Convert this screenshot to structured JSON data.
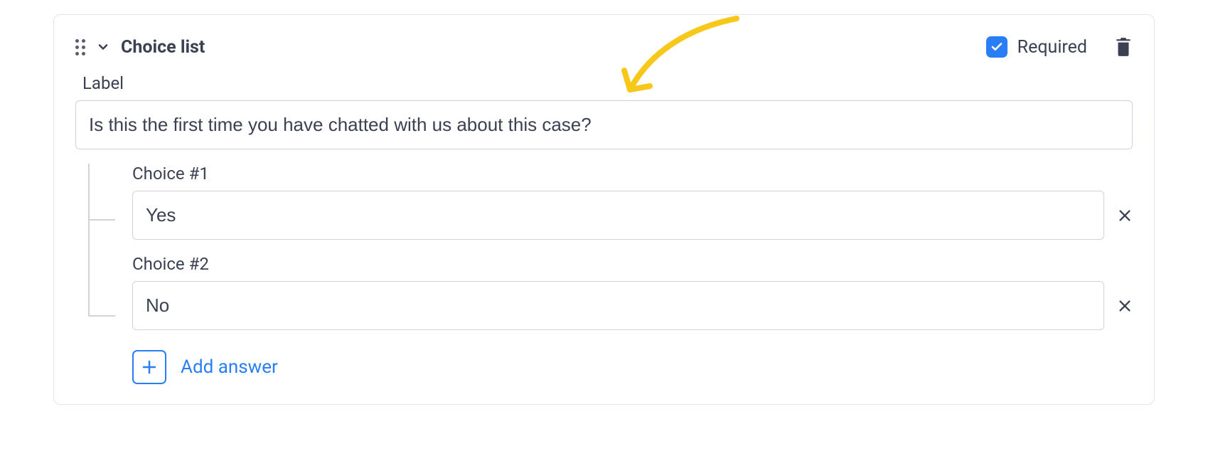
{
  "field": {
    "type_label": "Choice list",
    "required_label": "Required",
    "required_checked": true,
    "label_caption": "Label",
    "label_value": "Is this the first time you have chatted with us about this case?",
    "choices": [
      {
        "caption": "Choice #1",
        "value": "Yes"
      },
      {
        "caption": "Choice #2",
        "value": "No"
      }
    ],
    "add_answer_label": "Add answer"
  }
}
